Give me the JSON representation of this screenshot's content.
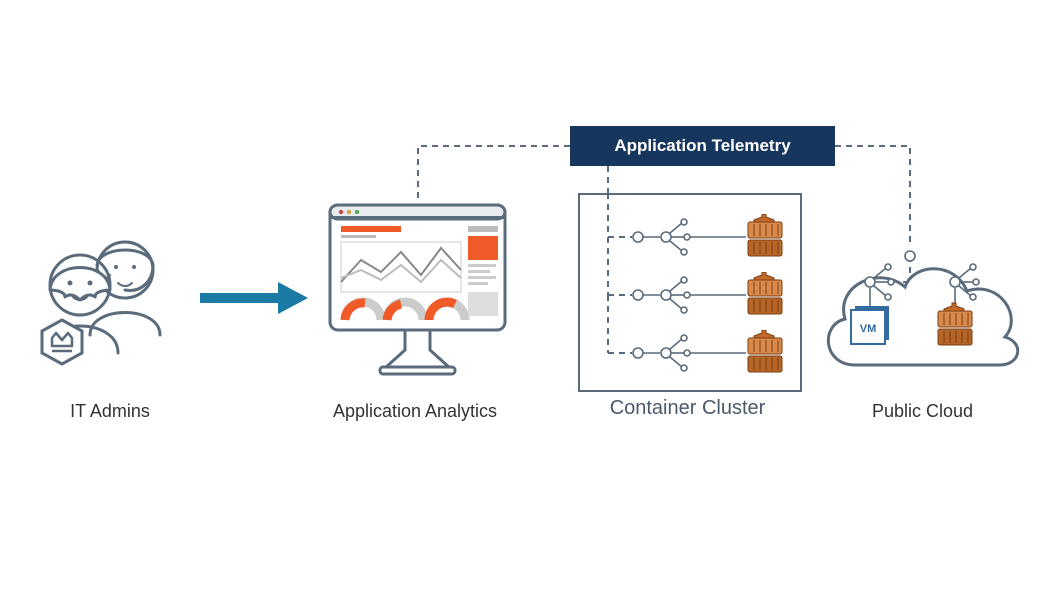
{
  "labels": {
    "it_admins": "IT Admins",
    "app_analytics": "Application Analytics",
    "container_cluster": "Container Cluster",
    "public_cloud": "Public Cloud",
    "telemetry": "Application Telemetry",
    "vm": "VM"
  },
  "colors": {
    "telemetry_bg": "#17365d",
    "arrow": "#1a7aa3",
    "outline": "#5a6b7b",
    "accent": "#f05a28",
    "container_light": "#d98a4a",
    "container_dark": "#b56526"
  }
}
